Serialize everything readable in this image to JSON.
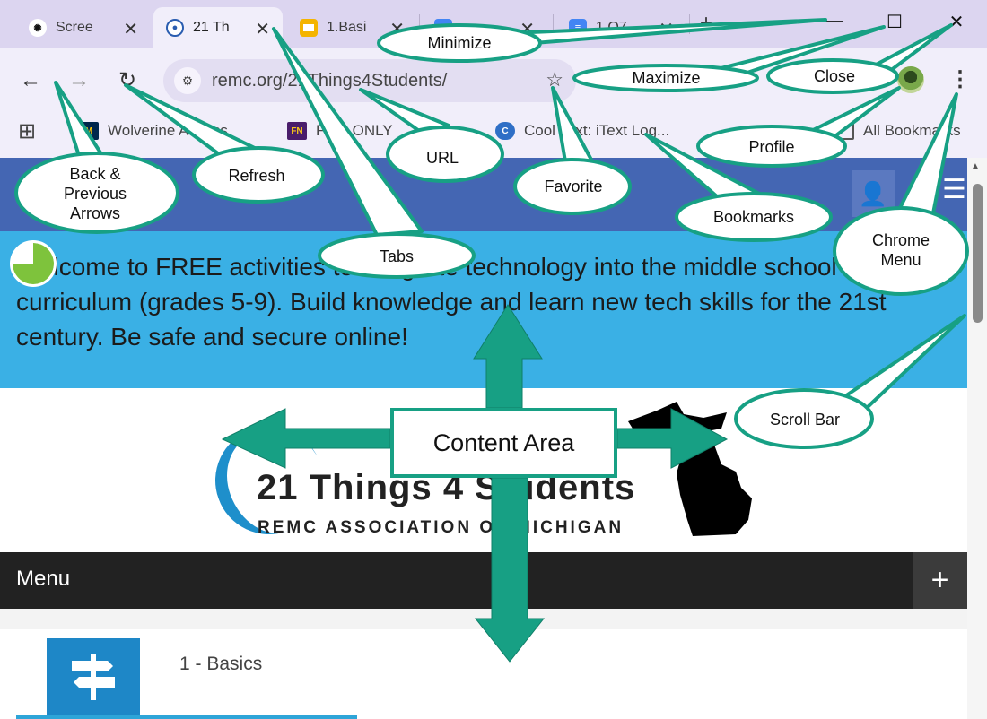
{
  "tabs": [
    {
      "title": "Scree",
      "favicon": "openai-icon"
    },
    {
      "title": "21 Th",
      "favicon": "remc-icon",
      "active": true
    },
    {
      "title": "1.Basi",
      "favicon": "slides-icon"
    },
    {
      "title": "",
      "favicon": "docs-icon"
    },
    {
      "title": "1 Q7",
      "favicon": "docs-icon"
    }
  ],
  "window": {
    "new_tab": "+",
    "minimize": "—",
    "maximize": "☐",
    "close": "✕"
  },
  "toolbar": {
    "back": "←",
    "forward": "→",
    "refresh": "↻",
    "url": "remc.org/21Things4Students/",
    "star": "☆",
    "menu": "⋮"
  },
  "bookmarks": {
    "apps": "apps-grid-icon",
    "items": [
      {
        "label": "Wolverine Access",
        "icon": "block-m-icon"
      },
      {
        "label": "Flix : ONLY",
        "icon": "flix-icon"
      },
      {
        "label": "Cool Text: iText Log...",
        "icon": "cooltext-icon"
      }
    ],
    "all_bookmarks": "All Bookmarks"
  },
  "site": {
    "hero_text": "Welcome to FREE activities to integrate technology into the middle school classroom curriculum (grades 5-9). Build knowledge and learn new tech skills for the 21st century. Be safe and secure online!",
    "brand_title": "21 Things 4 Students",
    "brand_sub": "REMC ASSOCIATION OF MICHIGAN",
    "menu_label": "Menu",
    "menu_toggle": "+",
    "first_item": "1 - Basics"
  },
  "annotations": {
    "minimize": "Minimize",
    "maximize": "Maximize",
    "close": "Close",
    "back": "Back & Previous Arrows",
    "refresh": "Refresh",
    "url": "URL",
    "favorite": "Favorite",
    "profile": "Profile",
    "bookmarks": "Bookmarks",
    "tabs": "Tabs",
    "chrome_menu": "Chrome Menu",
    "scroll_bar": "Scroll Bar",
    "content_area": "Content Area"
  },
  "colors": {
    "annotation_accent": "#17a084",
    "chrome_frame": "#dcd5f0",
    "site_header": "#4466b3",
    "hero": "#3ab0e5"
  }
}
